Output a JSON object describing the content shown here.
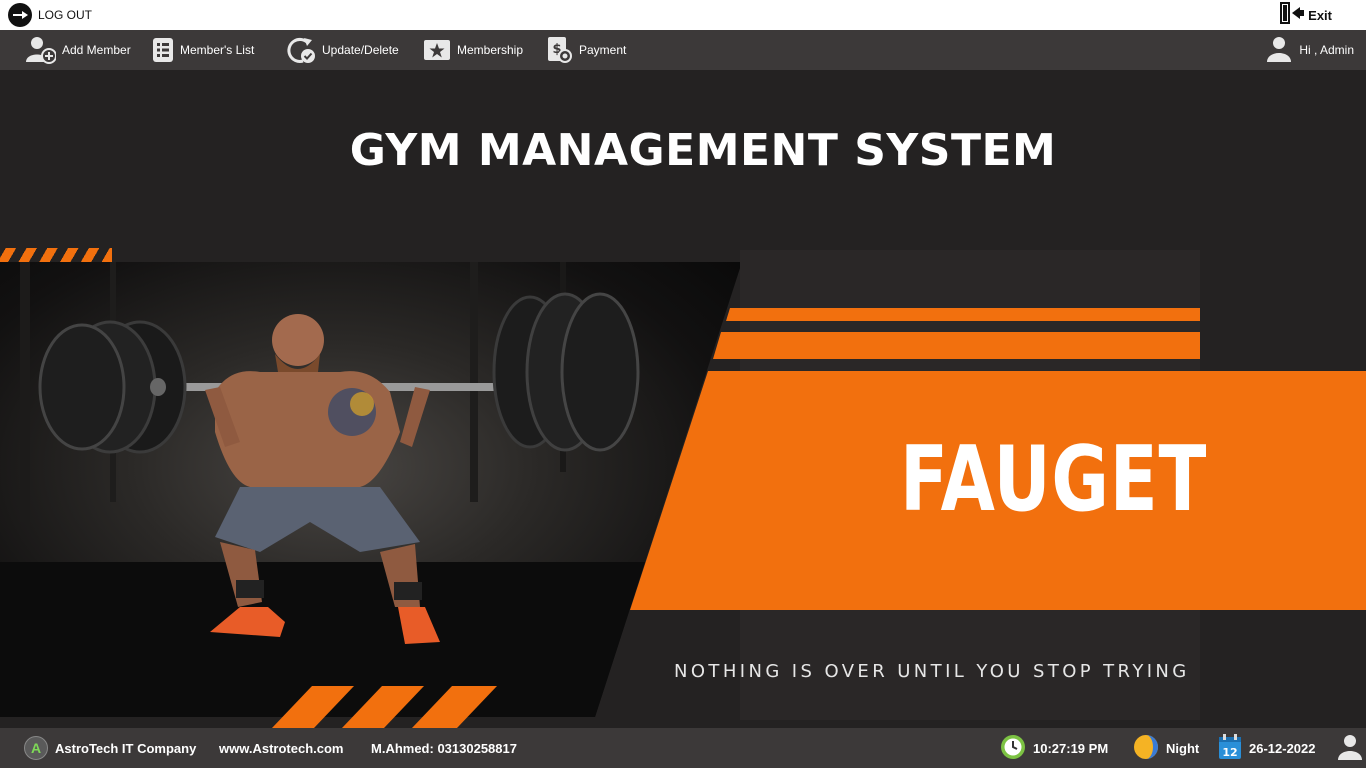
{
  "topbar": {
    "logout_label": "LOG OUT",
    "exit_label": "Exit"
  },
  "nav": {
    "items": [
      {
        "label": "Add Member",
        "icon": "add-user-icon"
      },
      {
        "label": "Member's List",
        "icon": "list-icon"
      },
      {
        "label": "Update/Delete",
        "icon": "refresh-check-icon"
      },
      {
        "label": "Membership",
        "icon": "star-card-icon"
      },
      {
        "label": "Payment",
        "icon": "money-icon"
      }
    ],
    "greeting": "Hi , Admin"
  },
  "main": {
    "title": "GYM MANAGEMENT SYSTEM",
    "brand": "FAUGET",
    "tagline": "NOTHING IS OVER UNTIL YOU STOP TRYING"
  },
  "status": {
    "company": "AstroTech IT Company",
    "company_logo_letter": "A",
    "website": "www.Astrotech.com",
    "contact": "M.Ahmed: 03130258817",
    "time": "10:27:19 PM",
    "period": "Night",
    "calendar_day": "12",
    "date": "26-12-2022"
  },
  "colors": {
    "accent": "#f2700e",
    "background": "#242222",
    "bar": "#3c3939"
  }
}
